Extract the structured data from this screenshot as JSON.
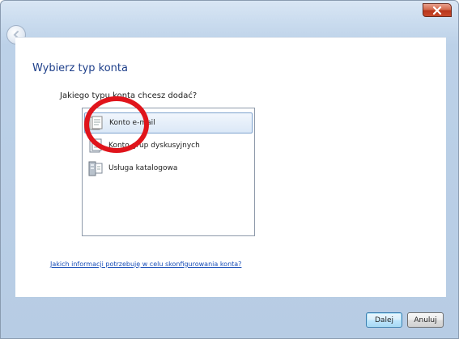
{
  "dialog": {
    "title": "Wybierz typ konta",
    "question": "Jakiego typu konta chcesz dodać?",
    "account_types": [
      {
        "label": "Konto e-mail",
        "icon": "email-account-icon",
        "selected": true
      },
      {
        "label": "Konto grup dyskusyjnych",
        "icon": "newsgroup-account-icon",
        "selected": false
      },
      {
        "label": "Usługa katalogowa",
        "icon": "directory-service-icon",
        "selected": false
      }
    ],
    "help_link": "Jakich informacji potrzebuję w celu skonfigurowania konta?",
    "next_label": "Dalej",
    "cancel_label": "Anuluj"
  },
  "colors": {
    "title_text": "#1e3f8a",
    "link": "#1a4fb8",
    "annotation_circle": "#e0141b",
    "close_button": "#c94a2b"
  }
}
